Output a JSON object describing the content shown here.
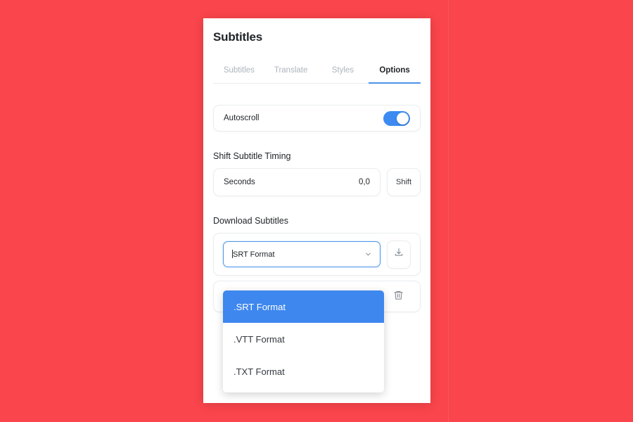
{
  "background": {
    "color": "#f9454b"
  },
  "panel": {
    "title": "Subtitles",
    "tabs": [
      {
        "label": "Subtitles",
        "active": false
      },
      {
        "label": "Translate",
        "active": false
      },
      {
        "label": "Styles",
        "active": false
      },
      {
        "label": "Options",
        "active": true
      }
    ],
    "autoscroll": {
      "label": "Autoscroll",
      "enabled": true,
      "toggle_color": "#3d8bf2"
    },
    "shift_section": {
      "title": "Shift Subtitle Timing",
      "input_placeholder": "Seconds",
      "input_value": "0,0",
      "button_label": "Shift"
    },
    "download_section": {
      "title": "Download Subtitles",
      "select_value": ".SRT Format",
      "select_value_display": "SRT Format",
      "download_icon": "download-icon",
      "chevron_icon": "chevron-down-icon",
      "delete_icon": "trash-icon",
      "focus_color": "#4d94e8"
    },
    "dropdown": {
      "options": [
        {
          "label": ".SRT Format",
          "selected": true
        },
        {
          "label": ".VTT Format",
          "selected": false
        },
        {
          "label": ".TXT Format",
          "selected": false
        }
      ],
      "highlight_color": "#3d87ee"
    }
  }
}
